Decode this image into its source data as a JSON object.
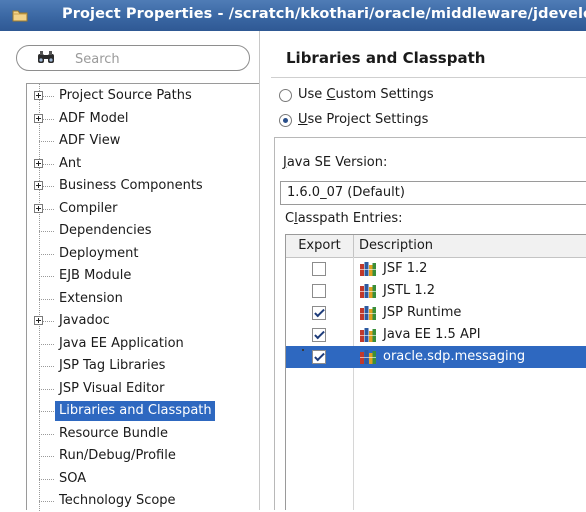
{
  "window": {
    "title": "Project Properties - /scratch/kkothari/oracle/middleware/jdevelo"
  },
  "search": {
    "placeholder": "Search"
  },
  "tree": {
    "items": [
      {
        "label": "Project Source Paths",
        "expandable": true
      },
      {
        "label": "ADF Model",
        "expandable": true
      },
      {
        "label": "ADF View",
        "expandable": false
      },
      {
        "label": "Ant",
        "expandable": true
      },
      {
        "label": "Business Components",
        "expandable": true
      },
      {
        "label": "Compiler",
        "expandable": true
      },
      {
        "label": "Dependencies",
        "expandable": false
      },
      {
        "label": "Deployment",
        "expandable": false
      },
      {
        "label": "EJB Module",
        "expandable": false
      },
      {
        "label": "Extension",
        "expandable": false
      },
      {
        "label": "Javadoc",
        "expandable": true
      },
      {
        "label": "Java EE Application",
        "expandable": false
      },
      {
        "label": "JSP Tag Libraries",
        "expandable": false
      },
      {
        "label": "JSP Visual Editor",
        "expandable": false
      },
      {
        "label": "Libraries and Classpath",
        "expandable": false,
        "selected": true
      },
      {
        "label": "Resource Bundle",
        "expandable": false
      },
      {
        "label": "Run/Debug/Profile",
        "expandable": false
      },
      {
        "label": "SOA",
        "expandable": false
      },
      {
        "label": "Technology Scope",
        "expandable": false
      }
    ]
  },
  "page": {
    "title": "Libraries and Classpath",
    "radio_custom": {
      "pre": "Use ",
      "mnemonic": "C",
      "post": "ustom Settings",
      "checked": false
    },
    "radio_project": {
      "pre": "",
      "mnemonic": "U",
      "post": "se Project Settings",
      "checked": true
    },
    "java_se_label": {
      "pre": "",
      "mnemonic": "J",
      "post": "ava SE Version:"
    },
    "java_se_value": "1.6.0_07 (Default)",
    "classpath_label": {
      "pre": "C",
      "mnemonic": "l",
      "post": "asspath Entries:"
    },
    "columns": {
      "export": "Export",
      "description": "Description"
    },
    "entries": [
      {
        "description": "JSF 1.2",
        "export": false,
        "selected": false
      },
      {
        "description": "JSTL 1.2",
        "export": false,
        "selected": false
      },
      {
        "description": "JSP Runtime",
        "export": true,
        "selected": false
      },
      {
        "description": "Java EE 1.5 API",
        "export": true,
        "selected": false
      },
      {
        "description": "oracle.sdp.messaging",
        "export": true,
        "selected": true
      }
    ]
  },
  "icons": {
    "app": "folder-project-icon",
    "search": "binoculars-icon",
    "library": "library-books-icon"
  },
  "colors": {
    "title_bar": "#3a67a3",
    "selection": "#2e68c0"
  }
}
